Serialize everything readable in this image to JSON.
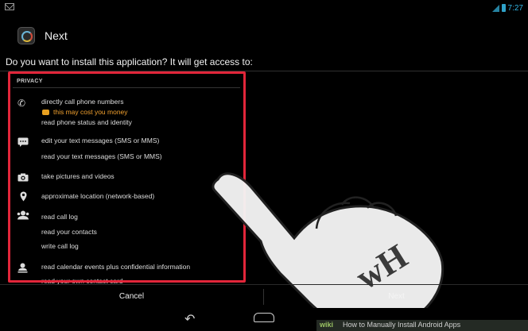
{
  "status_bar": {
    "time": "7:27"
  },
  "header": {
    "title": "Next"
  },
  "prompt": "Do you want to install this application? It will get access to:",
  "privacy": {
    "label": "PRIVACY",
    "groups": [
      {
        "icon": "phone-icon",
        "lines": [
          "directly call phone numbers",
          "this may cost you money",
          "read phone status and identity"
        ]
      },
      {
        "icon": "sms-icon",
        "lines": [
          "edit your text messages (SMS or MMS)",
          "read your text messages (SMS or MMS)"
        ]
      },
      {
        "icon": "camera-icon",
        "lines": [
          "take pictures and videos"
        ]
      },
      {
        "icon": "location-pin-icon",
        "lines": [
          "approximate location (network-based)"
        ]
      },
      {
        "icon": "contacts-icon",
        "lines": [
          "read call log",
          "read your contacts",
          "write call log"
        ]
      },
      {
        "icon": "calendar-person-icon",
        "lines": [
          "read calendar events plus confidential information",
          "read your own contact card"
        ]
      }
    ]
  },
  "buttons": {
    "cancel": "Cancel",
    "next": "Next"
  },
  "watermark": {
    "logo": "wH",
    "brand": "wiki",
    "text": "How to Manually Install Android Apps"
  },
  "colors": {
    "highlight": "#e2263a",
    "clock": "#33b5e5",
    "warning": "#f2a12e"
  }
}
